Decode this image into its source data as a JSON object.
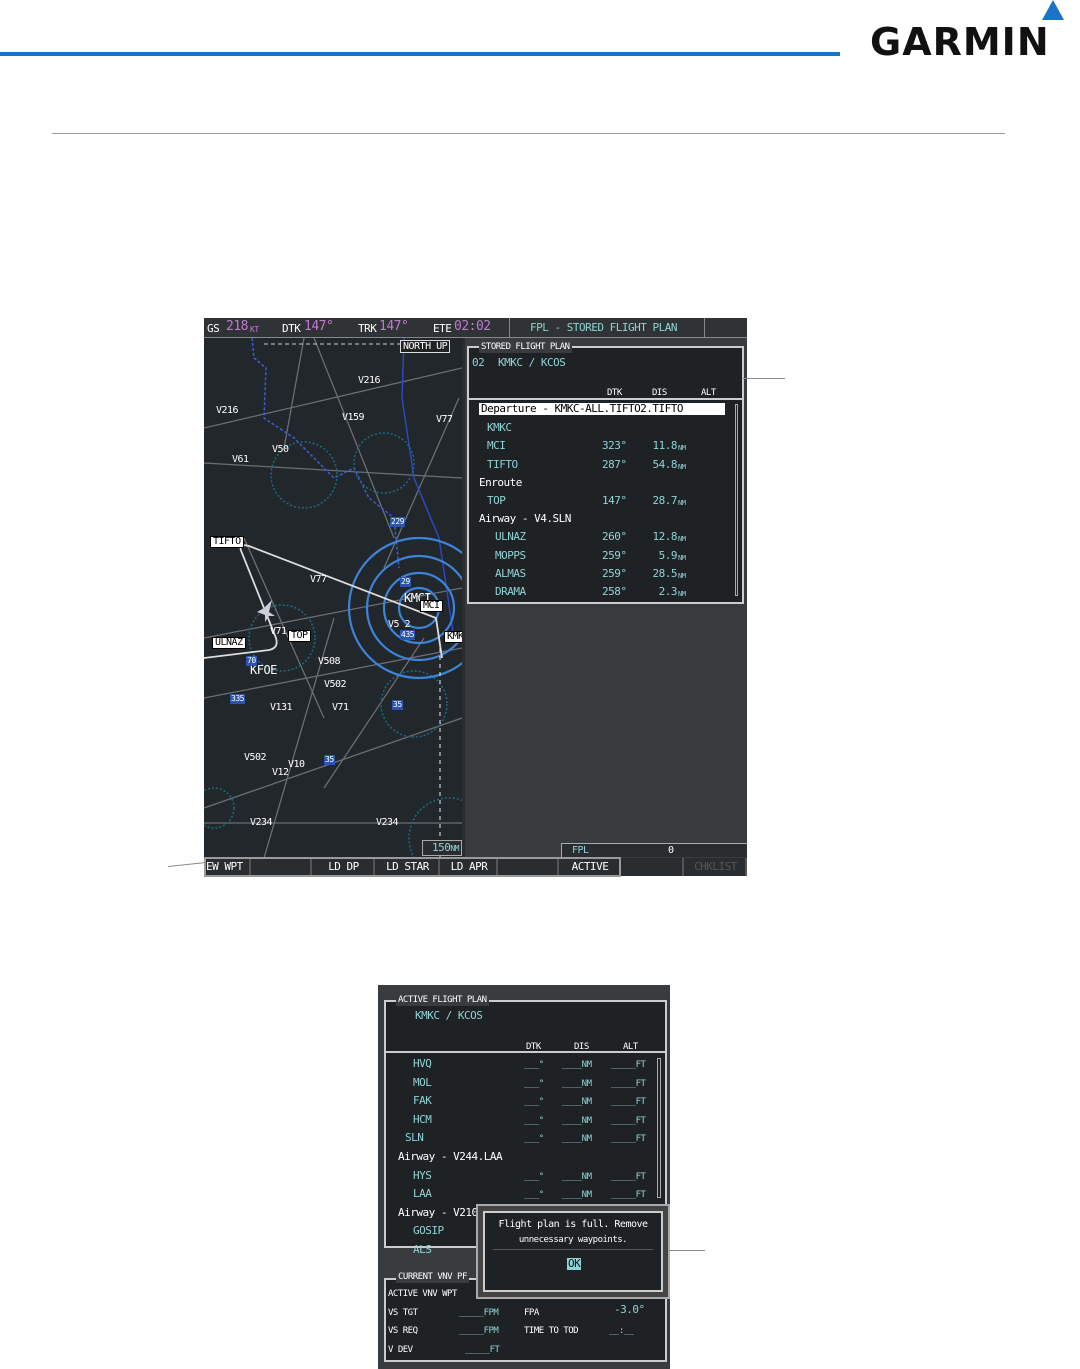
{
  "header": {
    "logo": "GARMIN",
    "accent_color": "#1a73c8"
  },
  "mfd": {
    "top_bar": {
      "gs_label": "GS",
      "gs_value": "218",
      "gs_unit": "KT",
      "dtk_label": "DTK",
      "dtk_value": "147°",
      "trk_label": "TRK",
      "trk_value": "147°",
      "ete_label": "ETE",
      "ete_value": "02:02",
      "page_title": "FPL - STORED FLIGHT PLAN"
    },
    "map": {
      "orientation": "NORTH UP",
      "range": "150",
      "range_unit": "NM",
      "labels": [
        "V216",
        "V216",
        "V159",
        "V77",
        "V50",
        "V61",
        "TIFTO",
        "V77",
        "KMCI",
        "MCI",
        "V5 2",
        "KMK",
        "V71",
        "TOP",
        "ULNAZ",
        "KFOE",
        "V508",
        "V502",
        "V131",
        "V71",
        "V502",
        "V10",
        "V12",
        "V234",
        "V234",
        "29",
        "229",
        "435",
        "70",
        "335",
        "35",
        "35"
      ]
    },
    "stored_plan": {
      "box_title": "STORED FLIGHT PLAN",
      "number": "02",
      "route": "KMKC / KCOS",
      "columns": [
        "DTK",
        "DIS",
        "ALT"
      ],
      "rows": [
        {
          "name": "Departure - KMKC-ALL.TIFTO2.TIFTO",
          "type": "header-selected"
        },
        {
          "name": "KMKC",
          "type": "wpt",
          "dtk": "",
          "dis": "",
          "unit": ""
        },
        {
          "name": "MCI",
          "type": "wpt",
          "dtk": "323°",
          "dis": "11.8",
          "unit": "NM"
        },
        {
          "name": "TIFTO",
          "type": "wpt",
          "dtk": "287°",
          "dis": "54.8",
          "unit": "NM"
        },
        {
          "name": "Enroute",
          "type": "header"
        },
        {
          "name": "TOP",
          "type": "wpt",
          "dtk": "147°",
          "dis": "28.7",
          "unit": "NM"
        },
        {
          "name": "Airway - V4.SLN",
          "type": "header"
        },
        {
          "name": "ULNAZ",
          "type": "wpt2",
          "dtk": "260°",
          "dis": "12.8",
          "unit": "NM"
        },
        {
          "name": "MOPPS",
          "type": "wpt2",
          "dtk": "259°",
          "dis": "5.9",
          "unit": "NM"
        },
        {
          "name": "ALMAS",
          "type": "wpt2",
          "dtk": "259°",
          "dis": "28.5",
          "unit": "NM"
        },
        {
          "name": "DRAMA",
          "type": "wpt2",
          "dtk": "258°",
          "dis": "2.3",
          "unit": "NM"
        }
      ]
    },
    "fpl_status": {
      "label": "FPL",
      "value": "0"
    },
    "softkeys": [
      "EW WPT",
      "",
      "LD DP",
      "LD STAR",
      "LD APR",
      "",
      "ACTIVE",
      "",
      "CHKLIST"
    ]
  },
  "active_plan": {
    "box_title": "ACTIVE FLIGHT PLAN",
    "route": "KMKC / KCOS",
    "columns": [
      "DTK",
      "DIS",
      "ALT"
    ],
    "rows": [
      {
        "name": "HVQ",
        "type": "wpt",
        "dtk": "___°",
        "dis": "____NM",
        "alt": "_____FT"
      },
      {
        "name": "MOL",
        "type": "wpt",
        "dtk": "___°",
        "dis": "____NM",
        "alt": "_____FT"
      },
      {
        "name": "FAK",
        "type": "wpt",
        "dtk": "___°",
        "dis": "____NM",
        "alt": "_____FT"
      },
      {
        "name": "HCM",
        "type": "wpt",
        "dtk": "___°",
        "dis": "____NM",
        "alt": "_____FT"
      },
      {
        "name": "SLN",
        "type": "wpt0",
        "dtk": "___°",
        "dis": "____NM",
        "alt": "_____FT"
      },
      {
        "name": "Airway - V244.LAA",
        "type": "header"
      },
      {
        "name": "HYS",
        "type": "wpt",
        "dtk": "___°",
        "dis": "____NM",
        "alt": "_____FT"
      },
      {
        "name": "LAA",
        "type": "wpt",
        "dtk": "___°",
        "dis": "____NM",
        "alt": "_____FT"
      },
      {
        "name": "Airway - V210.",
        "type": "header"
      },
      {
        "name": "GOSIP",
        "type": "wpt",
        "dtk": "",
        "dis": "",
        "alt": ""
      },
      {
        "name": "ALS",
        "type": "wpt",
        "dtk": "",
        "dis": "",
        "alt": ""
      }
    ],
    "vnv": {
      "box_title": "CURRENT VNV PF",
      "active_wpt_label": "ACTIVE VNV WPT",
      "vs_tgt_label": "VS TGT",
      "vs_tgt_value": "_____FPM",
      "fpa_label": "FPA",
      "fpa_value": "-3.0°",
      "vs_req_label": "VS REQ",
      "vs_req_value": "_____FPM",
      "time_to_tod_label": "TIME TO TOD",
      "time_to_tod_value": "__:__",
      "v_dev_label": "V DEV",
      "v_dev_value": "_____FT"
    },
    "dialog": {
      "message_line1": "Flight plan is full. Remove",
      "message_line2": "unnecessary waypoints.",
      "ok_label": "OK"
    }
  }
}
